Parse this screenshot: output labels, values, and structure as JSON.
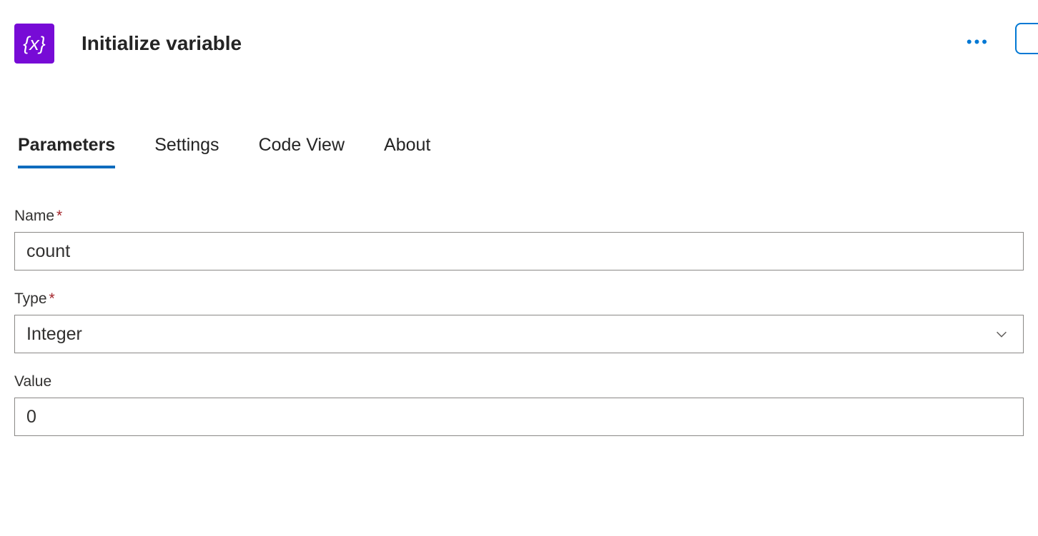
{
  "header": {
    "icon_text": "{x}",
    "title": "Initialize variable",
    "icon_bg": "#770BD6"
  },
  "tabs": [
    {
      "label": "Parameters",
      "active": true
    },
    {
      "label": "Settings",
      "active": false
    },
    {
      "label": "Code View",
      "active": false
    },
    {
      "label": "About",
      "active": false
    }
  ],
  "fields": {
    "name": {
      "label": "Name",
      "required": true,
      "value": "count"
    },
    "type": {
      "label": "Type",
      "required": true,
      "value": "Integer"
    },
    "value": {
      "label": "Value",
      "required": false,
      "value": "0"
    }
  }
}
